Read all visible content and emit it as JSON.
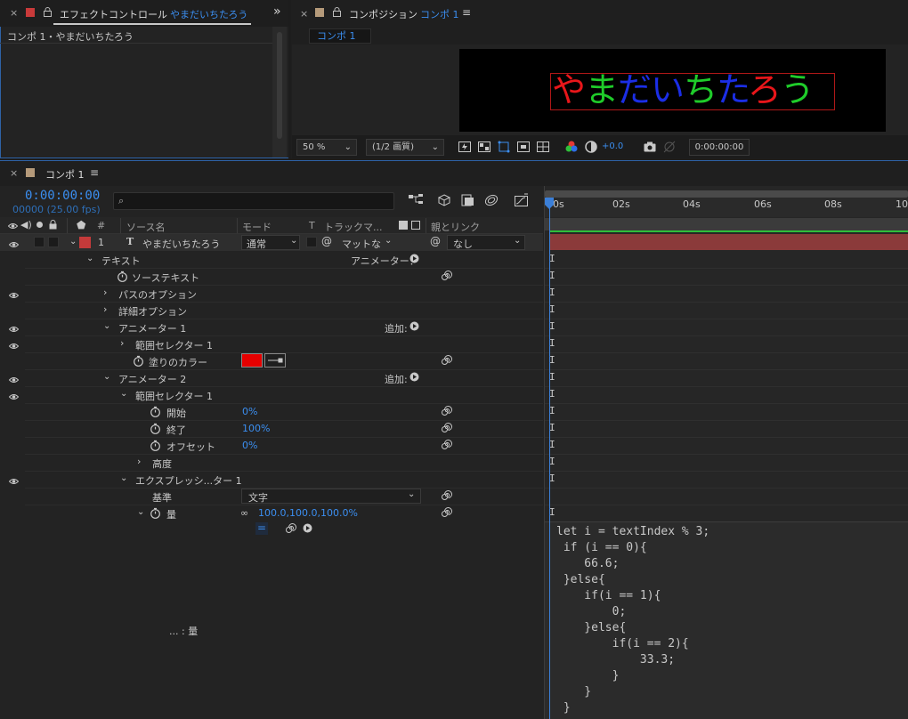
{
  "effect_controls": {
    "title": "エフェクトコントロール",
    "layer_name": "やまだいちたろう",
    "breadcrumb": "コンポ 1・やまだいちたろう"
  },
  "composition": {
    "title": "コンポジション",
    "comp_name": "コンポ 1",
    "sub_tab": "コンポ 1",
    "preview_chars": [
      {
        "ch": "や",
        "color": "#e8161a"
      },
      {
        "ch": "ま",
        "color": "#1fcc2a"
      },
      {
        "ch": "だ",
        "color": "#1b2ee6"
      },
      {
        "ch": "い",
        "color": "#1b2ee6"
      },
      {
        "ch": "ち",
        "color": "#1fcc2a"
      },
      {
        "ch": "た",
        "color": "#1b2ee6"
      },
      {
        "ch": "ろ",
        "color": "#e8161a"
      },
      {
        "ch": "う",
        "color": "#1fcc2a"
      }
    ],
    "zoom": "50 %",
    "resolution": "(1/2 画質)",
    "exposure": "+0.0",
    "timecode": "0:00:00:00"
  },
  "timeline": {
    "tab_title": "コンポ 1",
    "current_time": "0:00:00:00",
    "frames_fps": "00000 (25.00 fps)",
    "search_placeholder": "",
    "headers": {
      "num": "#",
      "source_name": "ソース名",
      "mode": "モード",
      "t": "T",
      "track_matte": "トラックマ...",
      "parent": "親とリンク"
    },
    "layer": {
      "index": "1",
      "type_glyph": "T",
      "name": "やまだいちたろう",
      "mode": "通常",
      "matte": "マットな",
      "parent": "なし"
    },
    "tree": {
      "text": "テキスト",
      "animator_menu": "アニメーター：",
      "source_text": "ソーステキスト",
      "path_options": "パスのオプション",
      "more_options": "詳細オプション",
      "animator1": "アニメーター 1",
      "add": "追加:",
      "range_selector1": "範囲セレクター 1",
      "fill_color": "塗りのカラー",
      "animator2": "アニメーター 2",
      "range_selector1b": "範囲セレクター 1",
      "start": "開始",
      "start_val": "0%",
      "end": "終了",
      "end_val": "100%",
      "offset": "オフセット",
      "offset_val": "0%",
      "advanced": "高度",
      "expression_selector": "エクスプレッシ...ター 1",
      "based_on": "基準",
      "based_on_val": "文字",
      "amount": "量",
      "amount_val": "100.0,100.0,100.0%",
      "footer_label": "... : 量"
    },
    "fill_color_value": "#e60000",
    "ruler_ticks": [
      "0s",
      "02s",
      "04s",
      "06s",
      "08s",
      "10"
    ],
    "expression": "let i = textIndex % 3;\n if (i == 0){\n    66.6;\n }else{\n    if(i == 1){\n        0;\n    }else{\n        if(i == 2){\n            33.3;\n        }\n    }\n }"
  }
}
